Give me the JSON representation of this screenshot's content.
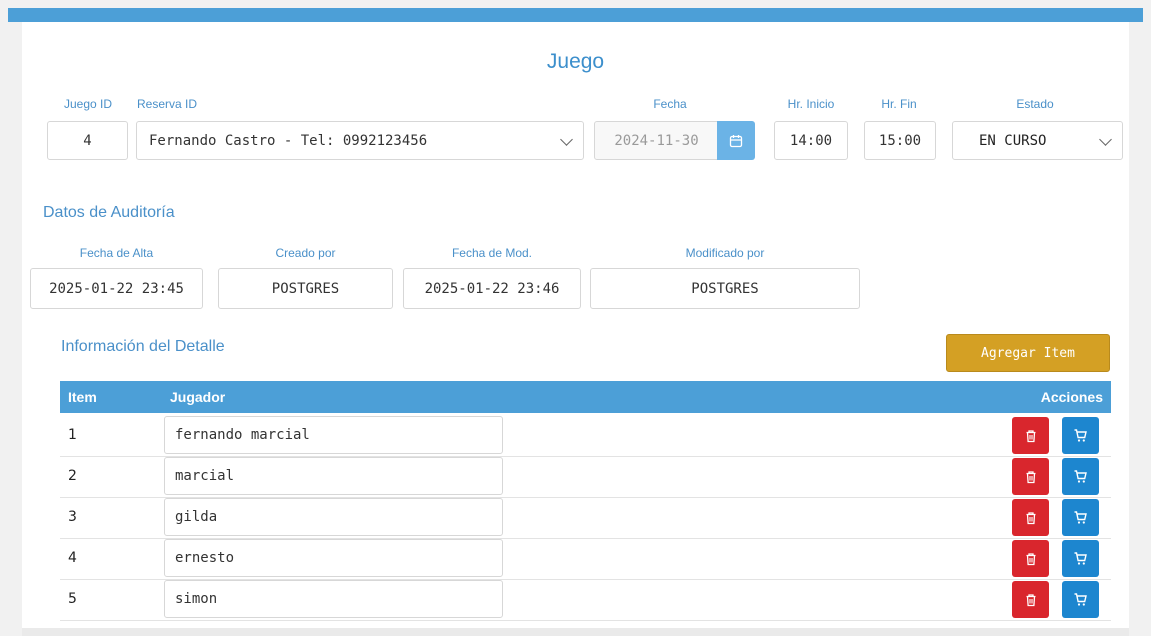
{
  "form": {
    "title": "Juego",
    "labels": {
      "juego_id": "Juego ID",
      "reserva_id": "Reserva ID",
      "fecha": "Fecha",
      "hr_inicio": "Hr. Inicio",
      "hr_fin": "Hr. Fin",
      "estado": "Estado"
    },
    "values": {
      "juego_id": "4",
      "reserva_id": "Fernando Castro - Tel: 0992123456",
      "fecha": "2024-11-30",
      "hr_inicio": "14:00",
      "hr_fin": "15:00",
      "estado": "EN CURSO"
    }
  },
  "audit": {
    "title": "Datos de Auditoría",
    "labels": {
      "fecha_alta": "Fecha de Alta",
      "creado_por": "Creado por",
      "fecha_mod": "Fecha de Mod.",
      "modificado_por": "Modificado por"
    },
    "values": {
      "fecha_alta": "2025-01-22 23:45",
      "creado_por": "POSTGRES",
      "fecha_mod": "2025-01-22 23:46",
      "modificado_por": "POSTGRES"
    }
  },
  "detail": {
    "title": "Información del Detalle",
    "add_button": "Agregar Item",
    "columns": {
      "item": "Item",
      "jugador": "Jugador",
      "acciones": "Acciones"
    },
    "rows": [
      {
        "item": "1",
        "jugador": "fernando marcial"
      },
      {
        "item": "2",
        "jugador": "marcial"
      },
      {
        "item": "3",
        "jugador": "gilda"
      },
      {
        "item": "4",
        "jugador": "ernesto"
      },
      {
        "item": "5",
        "jugador": "simon"
      }
    ]
  },
  "icons": {
    "dropdown": "chevron-down-icon",
    "calendar": "calendar-icon",
    "delete": "trash-icon",
    "cart": "cart-icon"
  },
  "colors": {
    "primary": "#4c9fd7",
    "warning": "#d4a024",
    "danger": "#d9262d",
    "info": "#1d86cf"
  }
}
